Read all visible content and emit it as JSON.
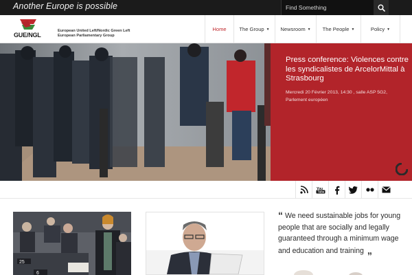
{
  "topbar": {
    "tagline": "Another Europe is possible",
    "search": {
      "placeholder": "Find Something"
    }
  },
  "header": {
    "logo_text": "GUE/NGL",
    "org_lines": [
      "European United Left/Nordic Green Left",
      "European Parliamentary Group"
    ],
    "nav": [
      {
        "label": "Home",
        "active": true,
        "dropdown": false
      },
      {
        "label": "The Group",
        "active": false,
        "dropdown": true
      },
      {
        "label": "Newsroom",
        "active": false,
        "dropdown": true
      },
      {
        "label": "The People",
        "active": false,
        "dropdown": true
      },
      {
        "label": "Policy",
        "active": false,
        "dropdown": true
      }
    ]
  },
  "hero": {
    "title": "Press conference: Violences contre les syndicalistes de ArcelorMittal à Strasbourg",
    "meta": "Mercredi 20 Février 2013, 14:30 , salle ASP 5G2, Parlement européen"
  },
  "social": [
    "rss-icon",
    "youtube-icon",
    "facebook-icon",
    "twitter-icon",
    "flickr-icon",
    "email-icon"
  ],
  "quote": {
    "text": "We need sustainable jobs for young people that are socially and legally guaranteed through a minimum wage and education and training"
  },
  "colors": {
    "brand_red": "#b2242a",
    "topbar": "#1b1b1b",
    "nav_active": "#c0282d"
  }
}
